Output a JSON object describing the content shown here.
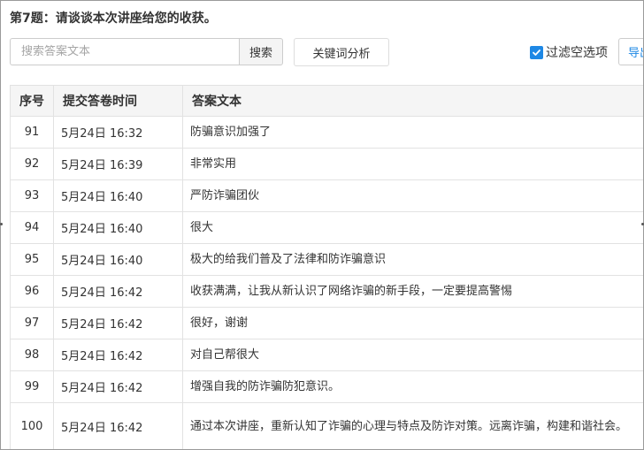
{
  "question": {
    "title": "第7题：请谈谈本次讲座给您的收获。"
  },
  "toolbar": {
    "search_placeholder": "搜索答案文本",
    "search_button": "搜索",
    "keyword_button": "关键词分析",
    "filter_label": "过滤空选项",
    "filter_checked": true,
    "export_button": "导出"
  },
  "colors": {
    "accent": "#1e88e5",
    "header_bg": "#f5f5f5",
    "border": "#e2e2e2"
  },
  "table": {
    "headers": [
      "序号",
      "提交答卷时间",
      "答案文本"
    ],
    "rows": [
      {
        "seq": "91",
        "time": "5月24日 16:32",
        "text": "防骗意识加强了"
      },
      {
        "seq": "92",
        "time": "5月24日 16:39",
        "text": "非常实用"
      },
      {
        "seq": "93",
        "time": "5月24日 16:40",
        "text": "严防诈骗团伙"
      },
      {
        "seq": "94",
        "time": "5月24日 16:40",
        "text": "很大"
      },
      {
        "seq": "95",
        "time": "5月24日 16:40",
        "text": "极大的给我们普及了法律和防诈骗意识"
      },
      {
        "seq": "96",
        "time": "5月24日 16:42",
        "text": "收获满满，让我从新认识了网络诈骗的新手段，一定要提高警惕"
      },
      {
        "seq": "97",
        "time": "5月24日 16:42",
        "text": "很好，谢谢"
      },
      {
        "seq": "98",
        "time": "5月24日 16:42",
        "text": "对自己帮很大"
      },
      {
        "seq": "99",
        "time": "5月24日 16:42",
        "text": "增强自我的防诈骗防犯意识。"
      },
      {
        "seq": "100",
        "time": "5月24日 16:42",
        "text": "通过本次讲座，重新认知了诈骗的心理与特点及防诈对策。远离诈骗，构建和谐社会。"
      }
    ]
  }
}
